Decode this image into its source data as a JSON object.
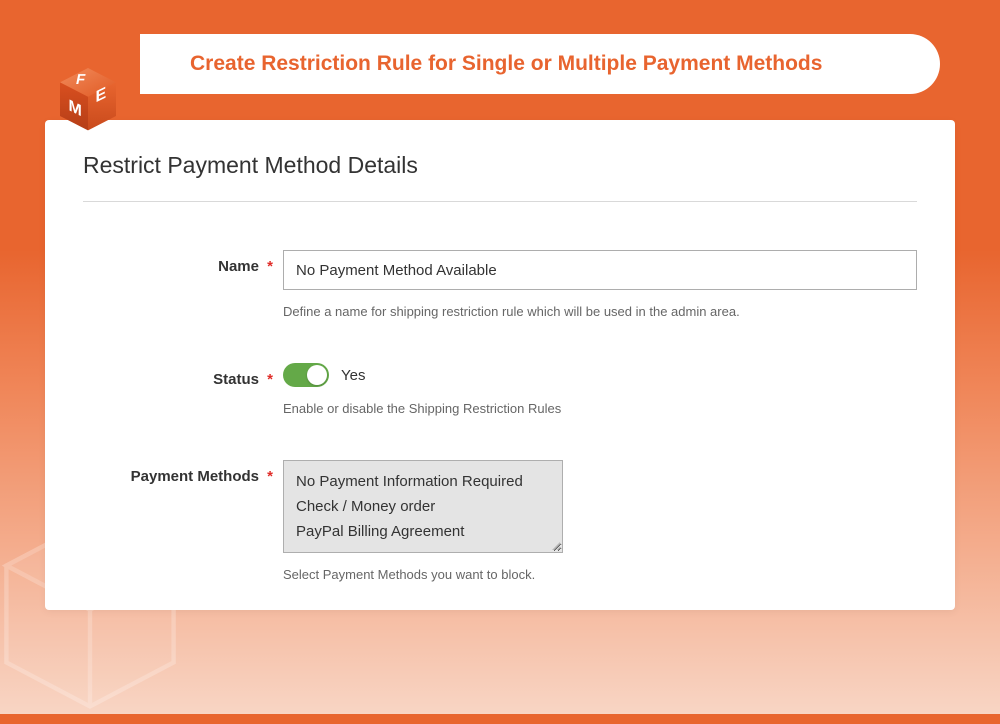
{
  "header": {
    "title": "Create Restriction Rule for Single or Multiple Payment Methods"
  },
  "panel": {
    "title": "Restrict Payment Method Details"
  },
  "form": {
    "name": {
      "label": "Name",
      "value": "No Payment Method Available",
      "help": "Define a name for shipping restriction rule which will be used in the admin area."
    },
    "status": {
      "label": "Status",
      "value_text": "Yes",
      "enabled": true,
      "help": "Enable or disable the Shipping Restriction Rules"
    },
    "payment_methods": {
      "label": "Payment Methods",
      "options": [
        "No Payment Information Required",
        "Check / Money order",
        "PayPal Billing Agreement"
      ],
      "help": "Select Payment Methods you want to block."
    }
  },
  "required_mark": "*",
  "colors": {
    "accent": "#e8642f",
    "toggle_on": "#64a948"
  }
}
